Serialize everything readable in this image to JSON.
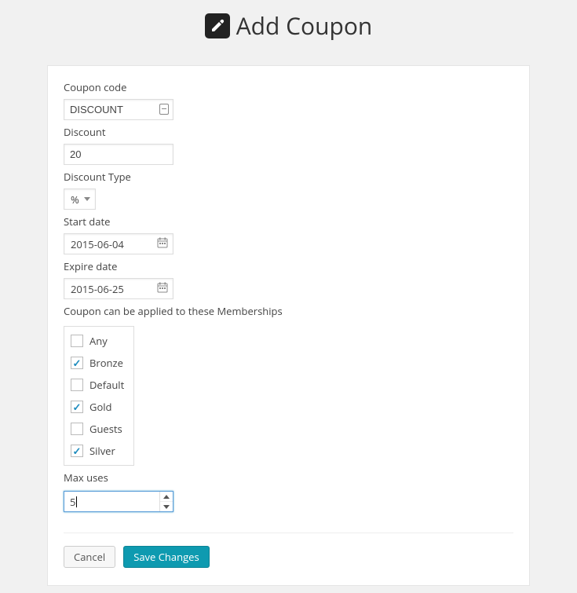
{
  "header": {
    "title": "Add Coupon"
  },
  "form": {
    "coupon_code": {
      "label": "Coupon code",
      "value": "DISCOUNT"
    },
    "discount": {
      "label": "Discount",
      "value": "20"
    },
    "discount_type": {
      "label": "Discount Type",
      "value": "%"
    },
    "start_date": {
      "label": "Start date",
      "value": "2015-06-04"
    },
    "expire_date": {
      "label": "Expire date",
      "value": "2015-06-25"
    },
    "memberships": {
      "label": "Coupon can be applied to these Memberships",
      "items": [
        {
          "label": "Any",
          "checked": false
        },
        {
          "label": "Bronze",
          "checked": true
        },
        {
          "label": "Default",
          "checked": false
        },
        {
          "label": "Gold",
          "checked": true
        },
        {
          "label": "Guests",
          "checked": false
        },
        {
          "label": "Silver",
          "checked": true
        }
      ]
    },
    "max_uses": {
      "label": "Max uses",
      "value": "5"
    }
  },
  "buttons": {
    "cancel": "Cancel",
    "save": "Save Changes"
  }
}
